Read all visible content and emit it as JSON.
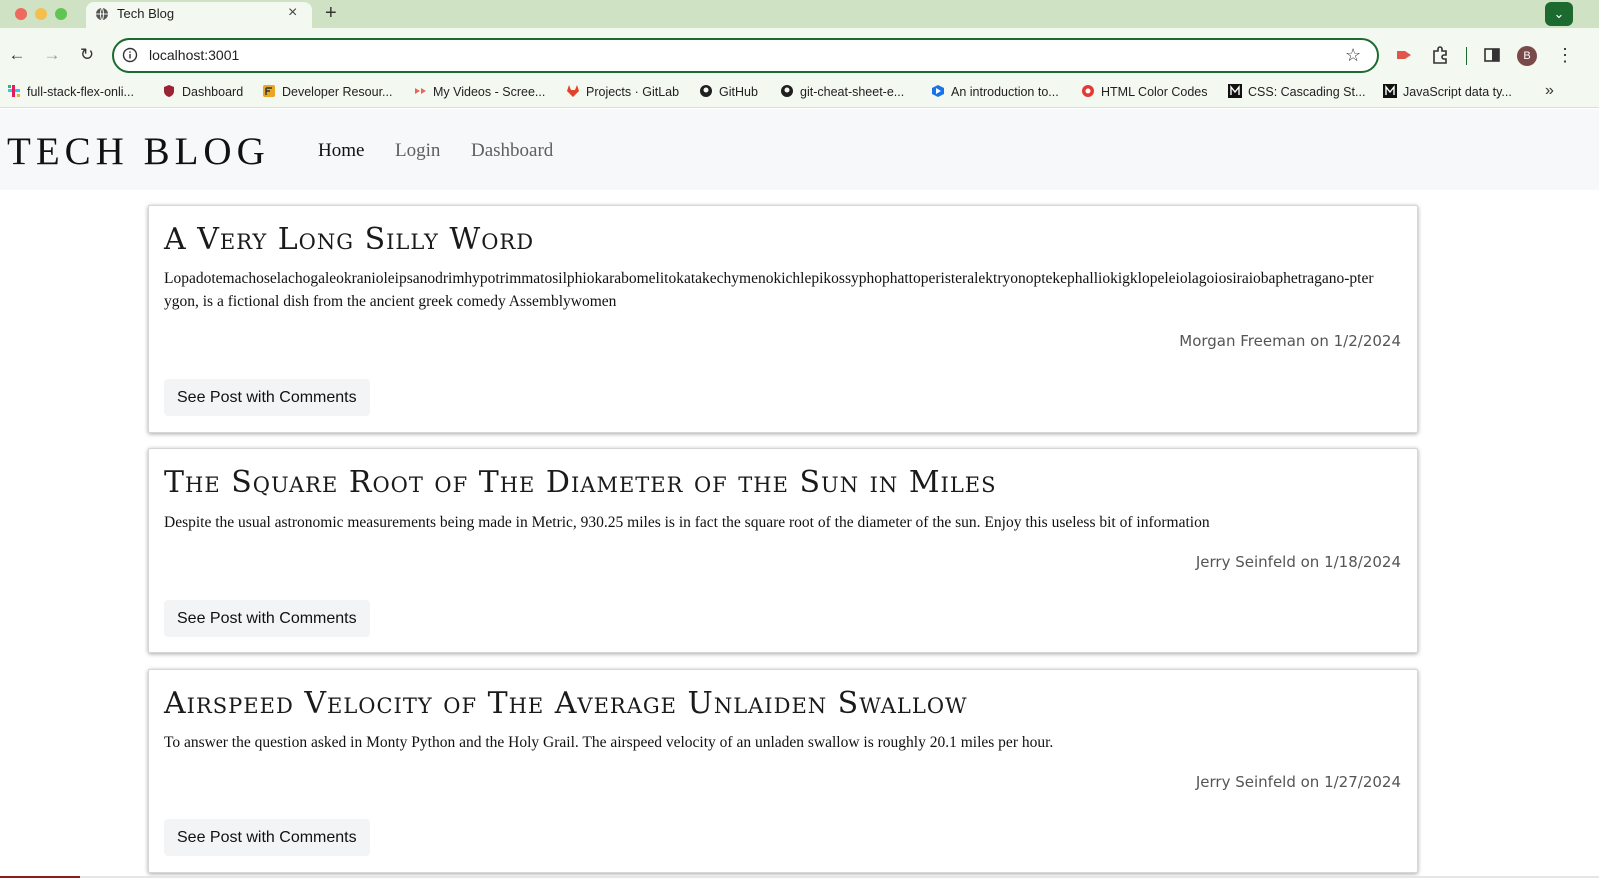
{
  "browser": {
    "tab_title": "Tech Blog",
    "tab_close": "×",
    "new_tab": "+",
    "tab_menu": "⌄",
    "back": "←",
    "forward": "→",
    "reload": "↻",
    "url": "localhost:3001",
    "star": "☆",
    "profile_initial": "B",
    "menu": "⋮",
    "accent_color": "#1c6a2f",
    "bookmarks": [
      "full-stack-flex-onli...",
      "Dashboard",
      "Developer Resour...",
      "My Videos - Scree...",
      "Projects · GitLab",
      "GitHub",
      "git-cheat-sheet-e...",
      "An introduction to...",
      "HTML Color Codes",
      "CSS: Cascading St...",
      "JavaScript data ty..."
    ],
    "bookmarks_more": "»"
  },
  "site": {
    "title": "TECH BLOG",
    "nav": [
      "Home",
      "Login",
      "Dashboard"
    ]
  },
  "posts": [
    {
      "title": "A Very Long Silly Word",
      "body": "Lopadotemachoselachogaleokranioleipsanodrimhypotrimmatosilphiokarabomelitokatakechymenokichlepikossyphophattoperisteralektryonoptekephalliokigklopeleiolagoiosiraiobaphetragano-pterygon, is a fictional dish from the ancient greek comedy Assemblywomen",
      "meta": "Morgan Freeman on 1/2/2024",
      "button": "See Post with Comments"
    },
    {
      "title": "The Square Root of The Diameter of the Sun in Miles",
      "body": "Despite the usual astronomic measurements being made in Metric, 930.25 miles is in fact the square root of the diameter of the sun. Enjoy this useless bit of information",
      "meta": "Jerry Seinfeld on 1/18/2024",
      "button": "See Post with Comments"
    },
    {
      "title": "Airspeed Velocity of The Average Unlaiden Swallow",
      "body": "To answer the question asked in Monty Python and the Holy Grail. The airspeed velocity of an unladen swallow is roughly 20.1 miles per hour.",
      "meta": "Jerry Seinfeld on 1/27/2024",
      "button": "See Post with Comments"
    }
  ]
}
